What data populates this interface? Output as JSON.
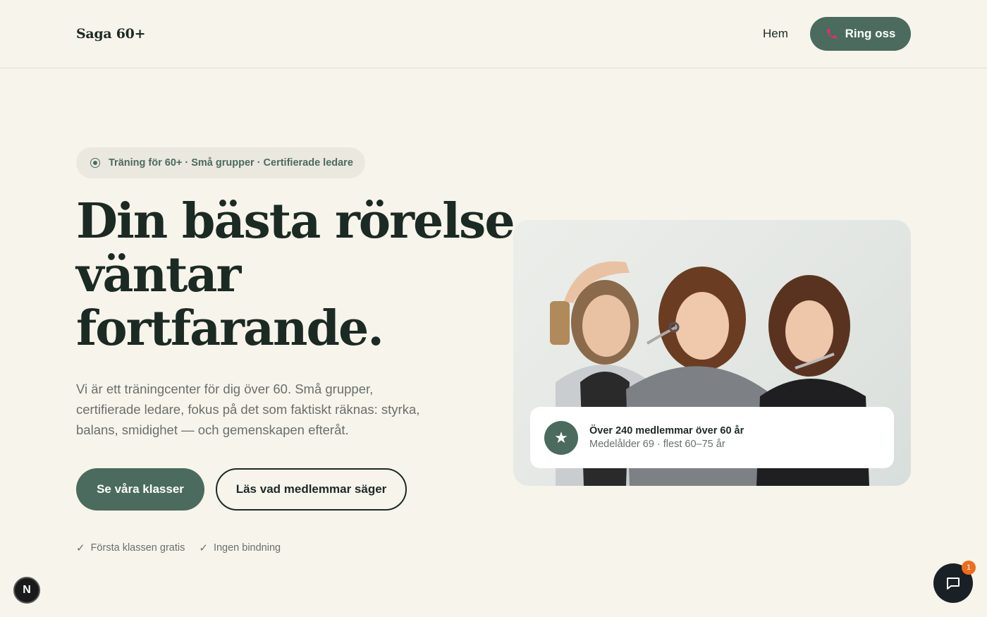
{
  "header": {
    "logo": "Saga 60+",
    "nav_home": "Hem",
    "call_label": "Ring oss"
  },
  "hero": {
    "badge": "Träning för 60+ · Små grupper · Certifierade ledare",
    "title_lines": [
      "Din bästa rörelse",
      "väntar",
      "fortfarande."
    ],
    "description": "Vi är ett träningcenter för dig över 60. Små grupper, certifierade ledare, fokus på det som faktiskt räknas: styrka, balans, smidighet — och gemenskapen efteråt.",
    "primary_button": "Se våra klasser",
    "secondary_button": "Läs vad medlemmar säger",
    "checks": [
      "Första klassen gratis",
      "Ingen bindning"
    ]
  },
  "stat": {
    "title": "Över 240 medlemmar över 60 år",
    "subtitle": "Medelålder 69 · flest 60–75 år"
  },
  "floating": {
    "n_badge": "N",
    "chat_count": "1"
  },
  "colors": {
    "background": "#f7f4ec",
    "accent": "#4a6b5e",
    "text": "#1c2a24",
    "muted": "#6a6f6b",
    "phone_icon": "#e0306a",
    "chat_badge": "#ef6c1a"
  }
}
